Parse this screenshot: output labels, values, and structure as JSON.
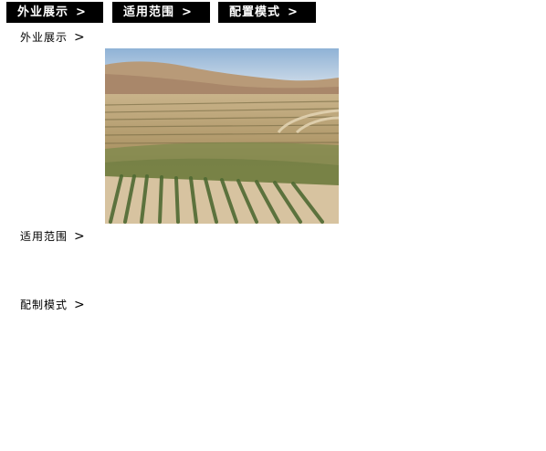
{
  "tabs": [
    {
      "label": "外业展示",
      "arrow": ">"
    },
    {
      "label": "适用范围",
      "arrow": ">"
    },
    {
      "label": "配置模式",
      "arrow": ">"
    }
  ],
  "sections": [
    {
      "label": "外业展示",
      "arrow": ">"
    },
    {
      "label": "适用范围",
      "arrow": ">"
    },
    {
      "label": "配制模式",
      "arrow": ">"
    }
  ],
  "photo": {
    "description_icon": "landscape-photo"
  }
}
